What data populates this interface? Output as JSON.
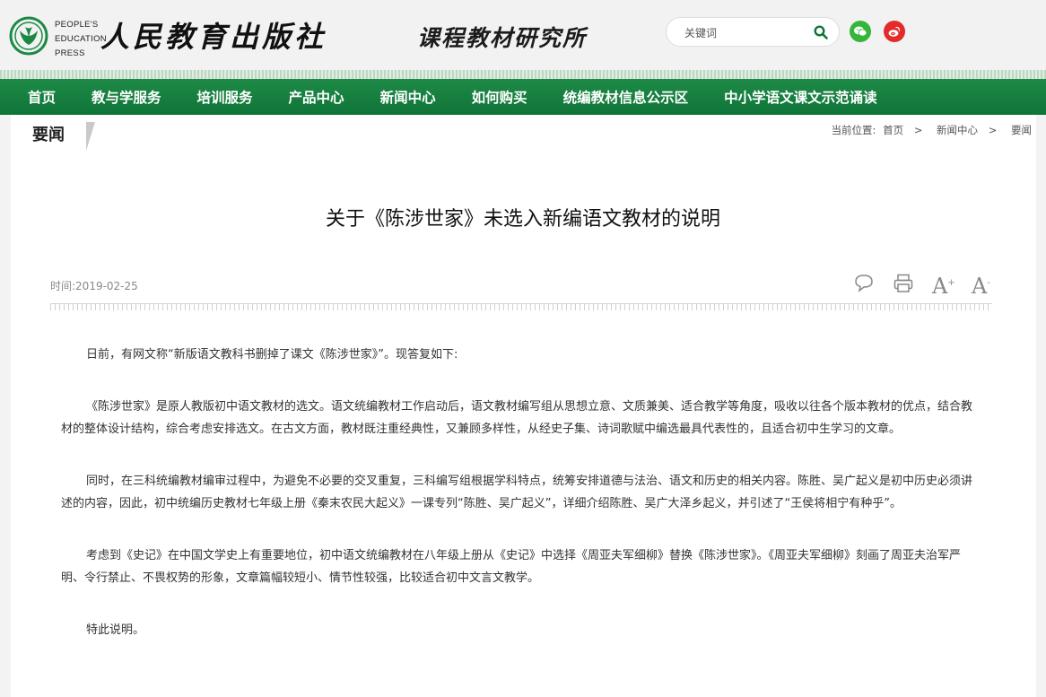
{
  "header": {
    "logo_line1": "PEOPLE'S",
    "logo_line2": "EDUCATION",
    "logo_line3": "PRESS",
    "brand_cn": "人民教育出版社",
    "brand_sub": "课程教材研究所",
    "search_placeholder": "关键词"
  },
  "nav": {
    "items": [
      "首页",
      "教与学服务",
      "培训服务",
      "产品中心",
      "新闻中心",
      "如何购买",
      "统编教材信息公示区",
      "中小学语文课文示范诵读"
    ]
  },
  "section": {
    "tab_label": "要闻"
  },
  "breadcrumb": {
    "prefix": "当前位置:",
    "items": [
      "首页",
      "新闻中心",
      "要闻"
    ],
    "separator": ">"
  },
  "article": {
    "title": "关于《陈涉世家》未选入新编语文教材的说明",
    "time": "时间:2019-02-25",
    "paragraphs": [
      "日前，有网文称“新版语文教科书删掉了课文《陈涉世家》”。现答复如下:",
      "《陈涉世家》是原人教版初中语文教材的选文。语文统编教材工作启动后，语文教材编写组从思想立意、文质兼美、适合教学等角度，吸收以往各个版本教材的优点，结合教材的整体设计结构，综合考虑安排选文。在古文方面，教材既注重经典性，又兼顾多样性，从经史子集、诗词歌赋中编选最具代表性的，且适合初中生学习的文章。",
      "同时，在三科统编教材编审过程中，为避免不必要的交叉重复，三科编写组根据学科特点，统筹安排道德与法治、语文和历史的相关内容。陈胜、吴广起义是初中历史必须讲述的内容，因此，初中统编历史教材七年级上册《秦末农民大起义》一课专列“陈胜、吴广起义”，详细介绍陈胜、吴广大泽乡起义，并引述了“王侯将相宁有种乎”。",
      "考虑到《史记》在中国文学史上有重要地位，初中语文统编教材在八年级上册从《史记》中选择《周亚夫军细柳》替换《陈涉世家》。《周亚夫军细柳》刻画了周亚夫治军严明、令行禁止、不畏权势的形象，文章篇幅较短小、情节性较强，比较适合初中文言文教学。",
      "特此说明。"
    ]
  },
  "tools": {
    "font_increase": "A",
    "font_decrease": "A",
    "plus": "+",
    "minus": "-"
  },
  "colors": {
    "nav_green": "#168040",
    "wechat": "#35b53b",
    "weibo": "#e42a2a"
  }
}
